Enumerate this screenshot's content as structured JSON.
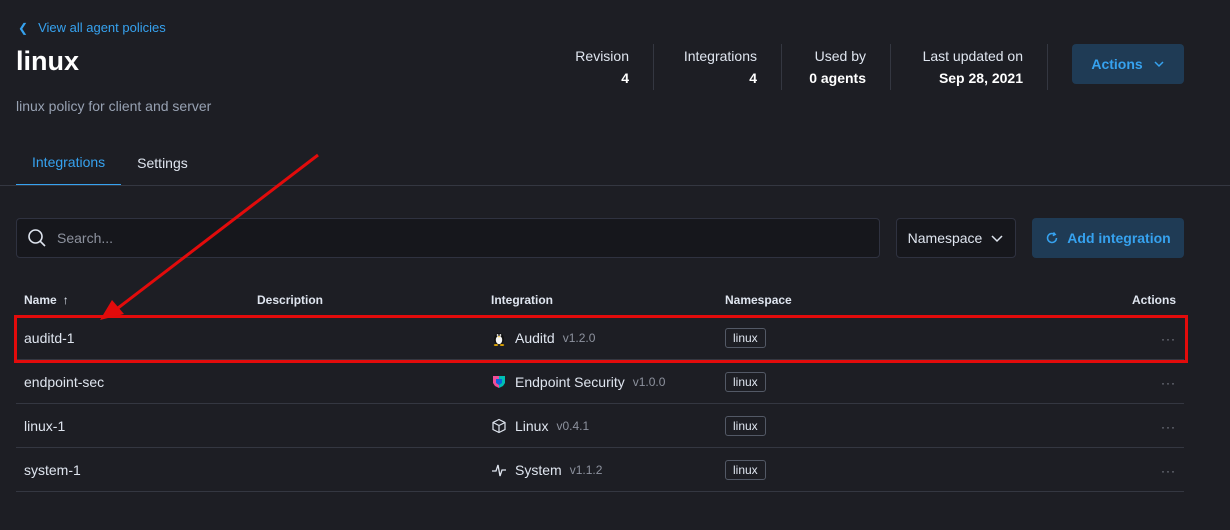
{
  "header": {
    "back_link": "View all agent policies",
    "title": "linux",
    "description": "linux policy for client and server",
    "stats": [
      {
        "label": "Revision",
        "value": "4"
      },
      {
        "label": "Integrations",
        "value": "4"
      },
      {
        "label": "Used by",
        "value": "0 agents"
      },
      {
        "label": "Last updated on",
        "value": "Sep 28, 2021"
      }
    ],
    "actions_label": "Actions"
  },
  "tabs": [
    {
      "label": "Integrations",
      "selected": true
    },
    {
      "label": "Settings",
      "selected": false
    }
  ],
  "toolbar": {
    "search_placeholder": "Search...",
    "namespace_label": "Namespace",
    "add_label": "Add integration"
  },
  "table": {
    "columns": {
      "name": "Name",
      "description": "Description",
      "integration": "Integration",
      "namespace": "Namespace",
      "actions": "Actions"
    },
    "sort_indicator": "↑",
    "rows": [
      {
        "name": "auditd-1",
        "description": "",
        "integration": "Auditd",
        "version": "v1.2.0",
        "icon": "penguin-icon",
        "namespace": "linux",
        "actions": "···"
      },
      {
        "name": "endpoint-sec",
        "description": "",
        "integration": "Endpoint Security",
        "version": "v1.0.0",
        "icon": "endpoint-security-icon",
        "namespace": "linux",
        "actions": "···"
      },
      {
        "name": "linux-1",
        "description": "",
        "integration": "Linux",
        "version": "v0.4.1",
        "icon": "cube-icon",
        "namespace": "linux",
        "actions": "···"
      },
      {
        "name": "system-1",
        "description": "",
        "integration": "System",
        "version": "v1.1.2",
        "icon": "pulse-icon",
        "namespace": "linux",
        "actions": "···"
      }
    ]
  },
  "colors": {
    "background": "#1d1e24",
    "accent": "#36a2ef",
    "annotation": "#e20b0b"
  }
}
